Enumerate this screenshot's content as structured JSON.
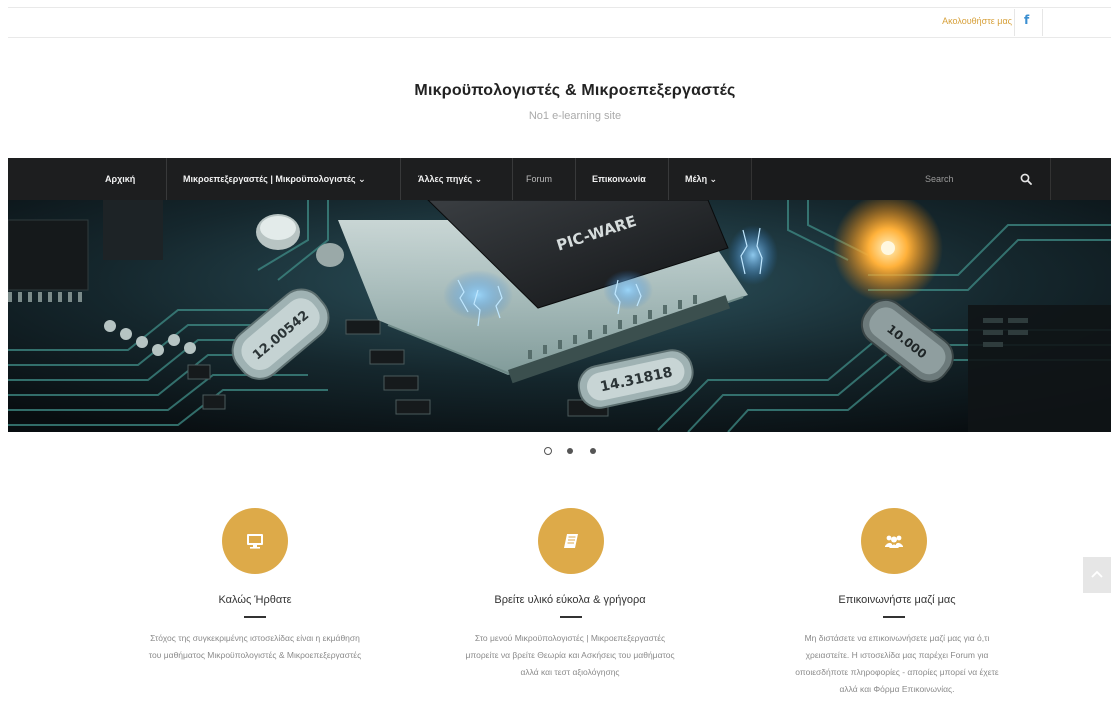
{
  "topbar": {
    "follow_label": "Ακολουθήστε μας",
    "facebook_icon": "f"
  },
  "site": {
    "title": "Μικροϋπολογιστές & Μικροεπεξεργαστές",
    "tagline": "No1 e-learning site"
  },
  "nav": {
    "items": [
      {
        "label": "Αρχική"
      },
      {
        "label": "Μικροεπεξεργαστές | Μικροϋπολογιστές ⌄"
      },
      {
        "label": "Άλλες πηγές ⌄"
      },
      {
        "label": "Forum"
      },
      {
        "label": "Επικοινωνία"
      },
      {
        "label": "Μέλη ⌄"
      }
    ],
    "search_placeholder": "Search"
  },
  "hero": {
    "chip_label": "PIC-WARE",
    "crystal1_label": "14.31818",
    "crystal2_label": "12.00542",
    "crystal3_label": "10.000"
  },
  "slider": {
    "slides": 3,
    "active": 0
  },
  "features": [
    {
      "icon": "monitor-icon",
      "title": "Καλώς Ήρθατε",
      "lines": [
        "Στόχος της συγκεκριμένης ιστοσελίδας είναι η εκμάθηση",
        "του μαθήματος Μικροϋπολογιστές & Μικροεπεξεργαστές"
      ]
    },
    {
      "icon": "book-icon",
      "title": "Βρείτε υλικό εύκολα & γρήγορα",
      "lines": [
        "Στο μενού Μικροϋπολογιστές | Μικροεπεξεργαστές",
        "μπορείτε να βρείτε Θεωρία και Ασκήσεις του μαθήματος",
        "αλλά και τεστ αξιολόγησης"
      ]
    },
    {
      "icon": "users-icon",
      "title": "Επικοινωνήστε μαζί μας",
      "lines": [
        "Μη διστάσετε να επικοινωνήσετε μαζί μας για ό,τι",
        "χρειαστείτε. Η ιστοσελίδα μας  παρέχει Forum για",
        "οποιεσδήποτε πληροφορίες - απορίες μπορεί να έχετε",
        "αλλά και Φόρμα Επικοινωνίας."
      ]
    }
  ],
  "colors": {
    "accent": "#ddaa49",
    "nav_bg": "#1d1e1f",
    "follow": "#d7a13b",
    "facebook": "#3b8fd1"
  }
}
